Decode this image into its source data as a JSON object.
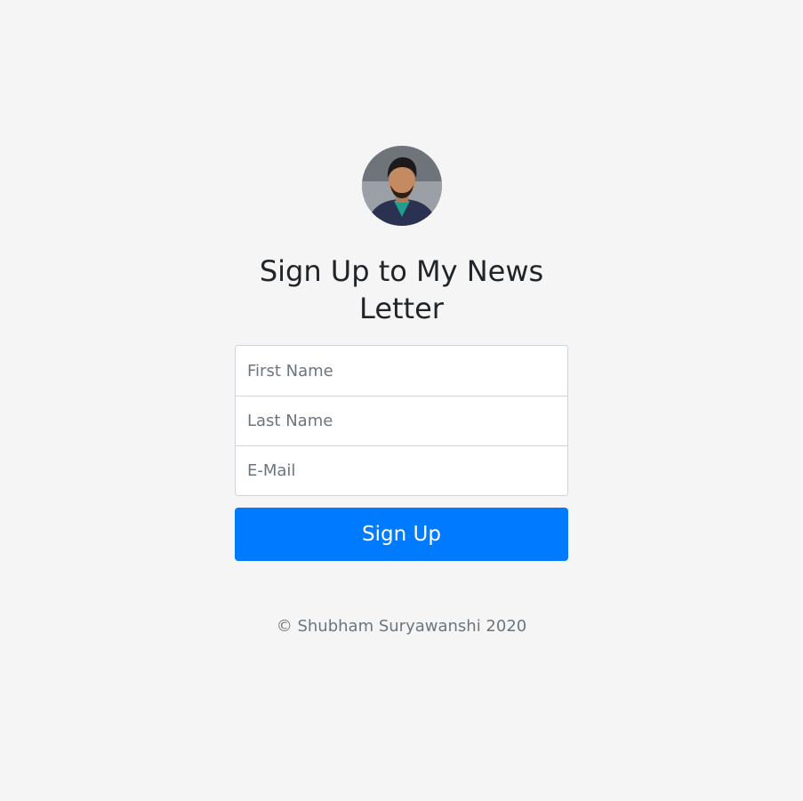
{
  "avatar": {
    "alt": "Profile photo"
  },
  "heading": {
    "title": "Sign Up to My News Letter"
  },
  "form": {
    "first_name_placeholder": "First Name",
    "last_name_placeholder": "Last Name",
    "email_placeholder": "E-Mail",
    "submit_label": "Sign Up"
  },
  "footer": {
    "copyright": "© Shubham Suryawanshi 2020"
  },
  "colors": {
    "background": "#f5f5f5",
    "primary": "#007bff",
    "text": "#212529",
    "muted": "#6c757d",
    "border": "#ced4da"
  }
}
